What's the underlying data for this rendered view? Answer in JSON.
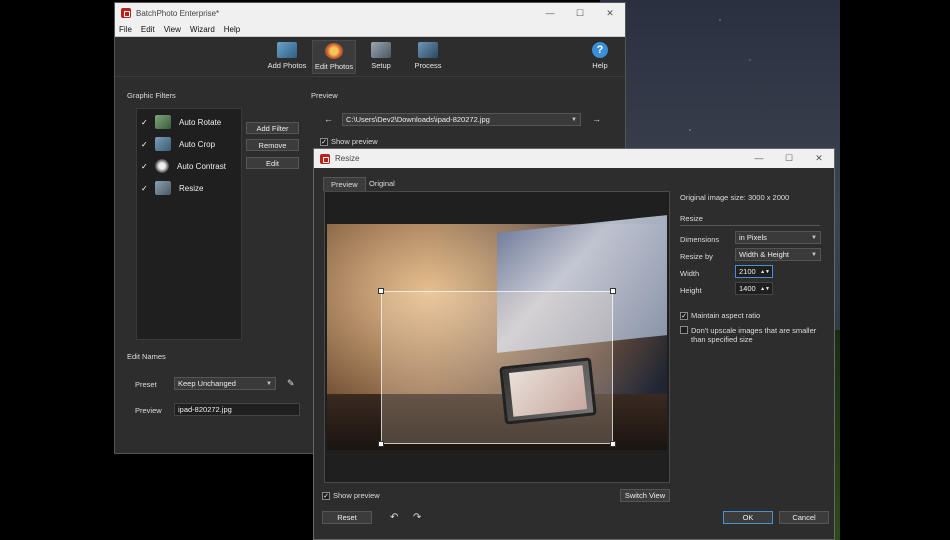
{
  "main_window": {
    "title": "BatchPhoto Enterprise*",
    "window_controls": [
      "—",
      "☐",
      "✕"
    ],
    "menu": [
      "File",
      "Edit",
      "View",
      "Wizard",
      "Help"
    ],
    "toolbar": {
      "add_photos": "Add Photos",
      "edit_photos": "Edit Photos",
      "setup": "Setup",
      "process": "Process",
      "help": "Help"
    },
    "graphic_filters": {
      "title": "Graphic Filters",
      "items": [
        {
          "label": "Auto Rotate",
          "checked": "✓"
        },
        {
          "label": "Auto Crop",
          "checked": "✓"
        },
        {
          "label": "Auto Contrast",
          "checked": "✓"
        },
        {
          "label": "Resize",
          "checked": "✓"
        }
      ],
      "buttons": {
        "add": "Add Filter",
        "remove": "Remove",
        "edit": "Edit"
      }
    },
    "preview": {
      "title": "Preview",
      "path": "C:\\Users\\Dev2\\Downloads\\ipad-820272.jpg",
      "show_preview": "Show preview",
      "show_preview_checked": "✓"
    },
    "edit_names": {
      "title": "Edit Names",
      "preset_label": "Preset",
      "preset_value": "Keep Unchanged",
      "preview_label": "Preview",
      "preview_value": "ipad-820272.jpg"
    }
  },
  "resize_dialog": {
    "title": "Resize",
    "window_controls": [
      "—",
      "☐",
      "✕"
    ],
    "tabs": [
      "Preview",
      "Original"
    ],
    "original_size": "Original image size: 3000 x 2000",
    "resize_header": "Resize",
    "dimensions_label": "Dimensions",
    "dimensions_value": "in Pixels",
    "resize_by_label": "Resize by",
    "resize_by_value": "Width & Height",
    "width_label": "Width",
    "width_value": "2100",
    "height_label": "Height",
    "height_value": "1400",
    "maintain_aspect": "Maintain aspect ratio",
    "maintain_aspect_checked": "✓",
    "no_upscale": "Don't upscale images that are smaller than specified size",
    "show_preview": "Show preview",
    "show_preview_checked": "✓",
    "switch_view": "Switch View",
    "reset": "Reset",
    "ok": "OK",
    "cancel": "Cancel"
  }
}
